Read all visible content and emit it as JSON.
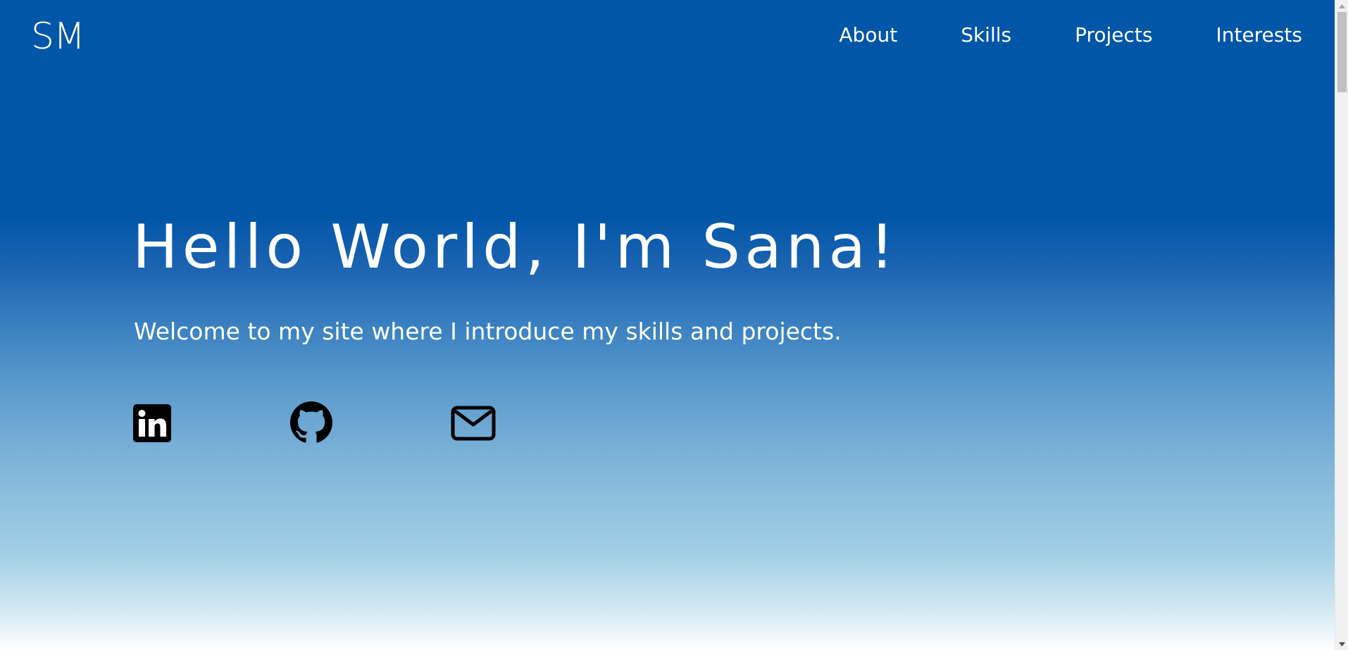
{
  "header": {
    "logo": "SM",
    "nav": [
      {
        "label": "About"
      },
      {
        "label": "Skills"
      },
      {
        "label": "Projects"
      },
      {
        "label": "Interests"
      }
    ]
  },
  "hero": {
    "title": "Hello World, I'm Sana!",
    "subtitle": "Welcome to my site where I introduce my skills and projects."
  },
  "social": [
    {
      "icon": "linkedin-icon"
    },
    {
      "icon": "github-icon"
    },
    {
      "icon": "mail-icon"
    }
  ],
  "colors": {
    "background_top": "#0256a8",
    "background_bottom": "#ffffff",
    "text": "#ffffff",
    "icons": "#000000",
    "scrollbar_track": "#f1f1f1",
    "scrollbar_thumb": "#c1c1c1"
  }
}
